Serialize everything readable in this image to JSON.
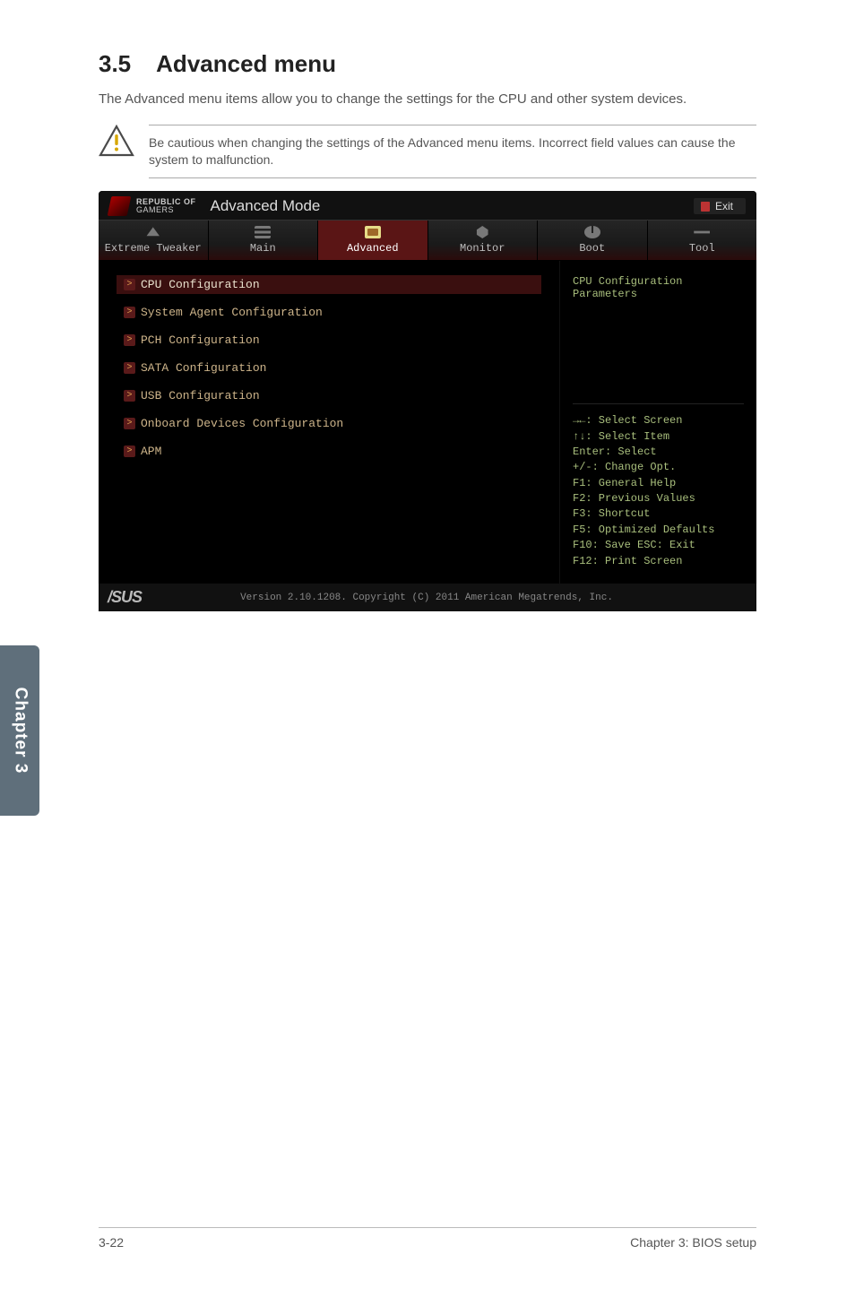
{
  "section": {
    "number": "3.5",
    "title": "Advanced menu"
  },
  "intro_text": "The Advanced menu items allow you to change the settings for the CPU and other system devices.",
  "note_text": "Be cautious when changing the settings of the Advanced menu items. Incorrect field values can cause the system to malfunction.",
  "bios": {
    "brand_top": "REPUBLIC OF",
    "brand_bottom": "GAMERS",
    "mode_label": "Advanced Mode",
    "exit_label": "Exit",
    "tabs": [
      {
        "label": "Extreme Tweaker",
        "icon": "tweaker",
        "active": false
      },
      {
        "label": "Main",
        "icon": "menu",
        "active": false
      },
      {
        "label": "Advanced",
        "icon": "chip",
        "active": true
      },
      {
        "label": "Monitor",
        "icon": "monitor",
        "active": false
      },
      {
        "label": "Boot",
        "icon": "power",
        "active": false
      },
      {
        "label": "Tool",
        "icon": "tool",
        "active": false
      }
    ],
    "options": [
      {
        "label": "CPU Configuration",
        "selected": true
      },
      {
        "label": "System Agent Configuration",
        "selected": false
      },
      {
        "label": "PCH Configuration",
        "selected": false
      },
      {
        "label": "SATA Configuration",
        "selected": false
      },
      {
        "label": "USB Configuration",
        "selected": false
      },
      {
        "label": "Onboard Devices Configuration",
        "selected": false
      },
      {
        "label": "APM",
        "selected": false
      }
    ],
    "help_title": "CPU Configuration Parameters",
    "fnkeys": [
      "→←: Select Screen",
      "↑↓: Select Item",
      "Enter: Select",
      "+/-: Change Opt.",
      "F1: General Help",
      "F2: Previous Values",
      "F3: Shortcut",
      "F5: Optimized Defaults",
      "F10: Save  ESC: Exit",
      "F12: Print Screen"
    ],
    "footer_brand": "/SUS",
    "version_text": "Version 2.10.1208. Copyright (C) 2011 American Megatrends, Inc."
  },
  "chapter_side": "Chapter 3",
  "footer": {
    "left": "3-22",
    "right": "Chapter 3: BIOS setup"
  }
}
